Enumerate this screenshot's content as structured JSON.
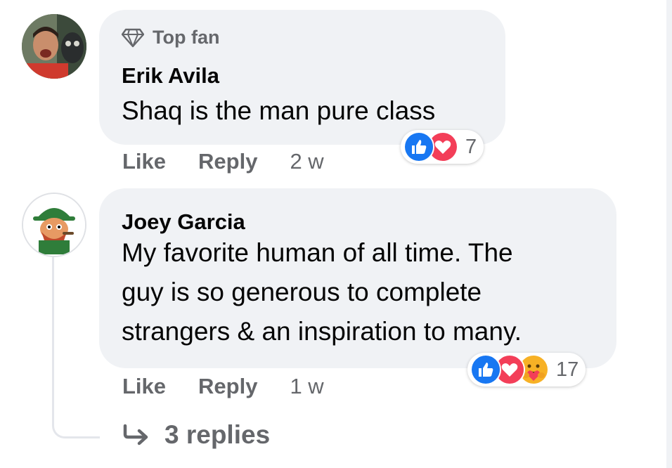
{
  "comments": [
    {
      "badge": "Top fan",
      "author": "Erik Avila",
      "text": "Shaq is the man pure class",
      "actions": {
        "like": "Like",
        "reply": "Reply",
        "time": "2 w"
      },
      "reactions": {
        "icons": [
          "like-icon",
          "love-icon"
        ],
        "count": "7"
      }
    },
    {
      "author": "Joey Garcia",
      "text_lines": [
        "My favorite human of all time. The",
        "guy is so generous to complete",
        "strangers & an inspiration to many."
      ],
      "actions": {
        "like": "Like",
        "reply": "Reply",
        "time": "1 w"
      },
      "reactions": {
        "icons": [
          "like-icon",
          "love-icon",
          "care-icon"
        ],
        "count": "17"
      },
      "replies_link": "3 replies"
    }
  ],
  "colors": {
    "bubble": "#f0f2f5",
    "secondary_text": "#65676b",
    "like_blue": "#1877f2",
    "love_red": "#f33e58",
    "care_yellow": "#f7b125"
  }
}
